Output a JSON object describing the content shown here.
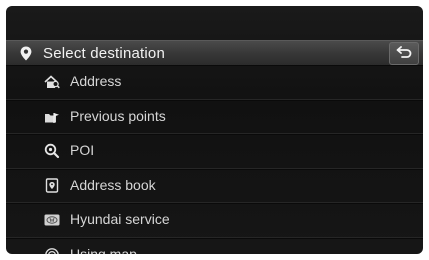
{
  "header": {
    "title": "Select destination",
    "pin_icon": "location-pin-icon",
    "back_icon": "back-arrow-icon"
  },
  "menu": {
    "items": [
      {
        "label": "Address",
        "icon": "house-search-icon"
      },
      {
        "label": "Previous points",
        "icon": "flag-folder-icon"
      },
      {
        "label": "POI",
        "icon": "magnifier-pin-icon"
      },
      {
        "label": "Address book",
        "icon": "address-book-icon"
      },
      {
        "label": "Hyundai service",
        "icon": "hyundai-logo-icon"
      },
      {
        "label": "Using map",
        "icon": "map-target-icon"
      }
    ]
  },
  "colors": {
    "background": "#121212",
    "title_bar": "#3a3a3a",
    "text": "#d6d6d6",
    "title_text": "#f2f2f2"
  }
}
